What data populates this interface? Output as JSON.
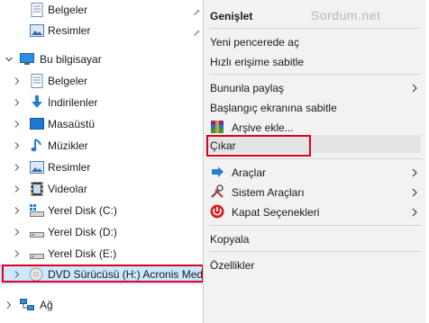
{
  "watermark": "Sordum.net",
  "tree": {
    "pinned": [
      {
        "label": "Belgeler",
        "icon": "document-icon"
      },
      {
        "label": "Resimler",
        "icon": "pictures-icon"
      }
    ],
    "this_pc": {
      "label": "Bu bilgisayar",
      "icon": "computer-icon"
    },
    "children": [
      {
        "label": "Belgeler",
        "icon": "document-icon"
      },
      {
        "label": "İndirilenler",
        "icon": "download-icon"
      },
      {
        "label": "Masaüstü",
        "icon": "desktop-icon"
      },
      {
        "label": "Müzikler",
        "icon": "music-icon"
      },
      {
        "label": "Resimler",
        "icon": "pictures-icon"
      },
      {
        "label": "Videolar",
        "icon": "video-icon"
      },
      {
        "label": "Yerel Disk (C:)",
        "icon": "drive-c-icon"
      },
      {
        "label": "Yerel Disk (D:)",
        "icon": "drive-icon"
      },
      {
        "label": "Yerel Disk (E:)",
        "icon": "drive-icon"
      },
      {
        "label": "DVD Sürücüsü (H:) Acronis Medi",
        "icon": "dvd-drive-icon",
        "selected": true
      }
    ],
    "network": {
      "label": "Ağ",
      "icon": "network-icon"
    }
  },
  "context_menu": {
    "items": [
      {
        "label": "Genişlet",
        "bold": true
      },
      {
        "label": "Yeni pencerede aç"
      },
      {
        "label": "Hızlı erişime sabitle"
      },
      {
        "label": "Bununla paylaş",
        "submenu": true
      },
      {
        "label": "Başlangıç ekranına sabitle"
      },
      {
        "label": "Arşive ekle...",
        "icon": "winrar-icon"
      },
      {
        "label": "Çıkar",
        "highlighted": true
      },
      {
        "label": "Araçlar",
        "icon": "tools-arrow-icon",
        "submenu": true
      },
      {
        "label": "Sistem Araçları",
        "icon": "system-tools-icon",
        "submenu": true
      },
      {
        "label": "Kapat Seçenekleri",
        "icon": "power-icon",
        "submenu": true
      },
      {
        "label": "Kopyala"
      },
      {
        "label": "Özellikler"
      }
    ]
  },
  "colors": {
    "accent_red": "#e0001a",
    "menu_bg": "#f2f2f2",
    "highlight": "#e4e4e4"
  }
}
